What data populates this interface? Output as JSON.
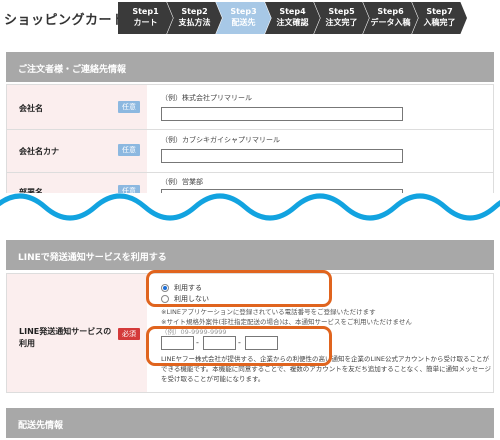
{
  "header": {
    "title": "ショッピングカート",
    "steps": [
      {
        "num": "Step1",
        "label": "カート",
        "active": false
      },
      {
        "num": "Step2",
        "label": "支払方法",
        "active": false
      },
      {
        "num": "Step3",
        "label": "配送先",
        "active": true
      },
      {
        "num": "Step4",
        "label": "注文確認",
        "active": false
      },
      {
        "num": "Step5",
        "label": "注文完了",
        "active": false
      },
      {
        "num": "Step6",
        "label": "データ入稿",
        "active": false
      },
      {
        "num": "Step7",
        "label": "入稿完了",
        "active": false
      }
    ]
  },
  "orderer_section": {
    "title": "ご注文者様・ご連絡先情報",
    "company": {
      "label": "会社名",
      "badge": "任意",
      "example": "（例）株式会社プリマリール",
      "value": ""
    },
    "company_kana": {
      "label": "会社名カナ",
      "badge": "任意",
      "example": "（例）カブシキガイシャプリマリール",
      "value": ""
    },
    "department": {
      "label": "部署名",
      "badge": "任意",
      "example": "（例）営業部",
      "value": ""
    }
  },
  "line_section": {
    "title": "LINEで発送通知サービスを利用する",
    "field_label": "LINE発送通知サービスの利用",
    "badge": "必須",
    "options": [
      "利用する",
      "利用しない"
    ],
    "selected": "利用する",
    "note1": "※LINEアプリケーションに登録されている電話番号をご登録いただけます",
    "note2": "※サイト規格外案件(非社指定配送の場合)は、本通知サービスをご利用いただけません",
    "tel_example": "（例）09-9999-9999",
    "tel": [
      "",
      "",
      ""
    ],
    "desc": "LINEヤフー株式会社が提供する、企業からの利便性の高い通知を企業のLINE公式アカウントから受け取ることができる機能です。本機能に同意することで、複数のアカウントを友だち追加することなく、簡単に通知メッセージを受け取ることが可能になります。"
  },
  "delivery_section": {
    "title": "配送先情報"
  },
  "colors": {
    "header_step": "#3a3a3a",
    "active_step": "#a7c8e6",
    "section_bg": "#a8a8a8",
    "label_bg": "#fbeeee",
    "optional_badge": "#8cb8e0",
    "required_badge": "#d43a3a",
    "highlight": "#e0641e",
    "wave": "#12a3e0"
  }
}
